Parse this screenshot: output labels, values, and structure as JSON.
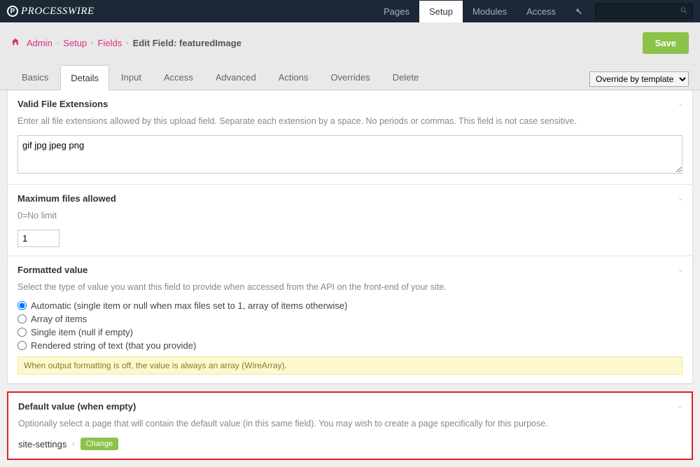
{
  "logo": "PROCESSWIRE",
  "topnav": {
    "pages": "Pages",
    "setup": "Setup",
    "modules": "Modules",
    "access": "Access"
  },
  "breadcrumbs": {
    "admin": "Admin",
    "setup": "Setup",
    "fields": "Fields",
    "current": "Edit Field: featuredImage"
  },
  "save_btn": "Save",
  "tabs": {
    "basics": "Basics",
    "details": "Details",
    "input": "Input",
    "access": "Access",
    "advanced": "Advanced",
    "actions": "Actions",
    "overrides": "Overrides",
    "delete": "Delete"
  },
  "override_select": "Override by template",
  "sections": {
    "ext": {
      "title": "Valid File Extensions",
      "help": "Enter all file extensions allowed by this upload field. Separate each extension by a space. No periods or commas. This field is not case sensitive.",
      "value": "gif jpg jpeg png"
    },
    "maxfiles": {
      "title": "Maximum files allowed",
      "help": "0=No limit",
      "value": "1"
    },
    "formatted": {
      "title": "Formatted value",
      "help": "Select the type of value you want this field to provide when accessed from the API on the front-end of your site.",
      "options": [
        "Automatic (single item or null when max files set to 1, array of items otherwise)",
        "Array of items",
        "Single item (null if empty)",
        "Rendered string of text (that you provide)"
      ],
      "note": "When output formatting is off, the value is always an array (WireArray)."
    },
    "default": {
      "title": "Default value (when empty)",
      "help": "Optionally select a page that will contain the default value (in this same field). You may wish to create a page specifically for this purpose.",
      "page": "site-settings",
      "change": "Change"
    }
  }
}
